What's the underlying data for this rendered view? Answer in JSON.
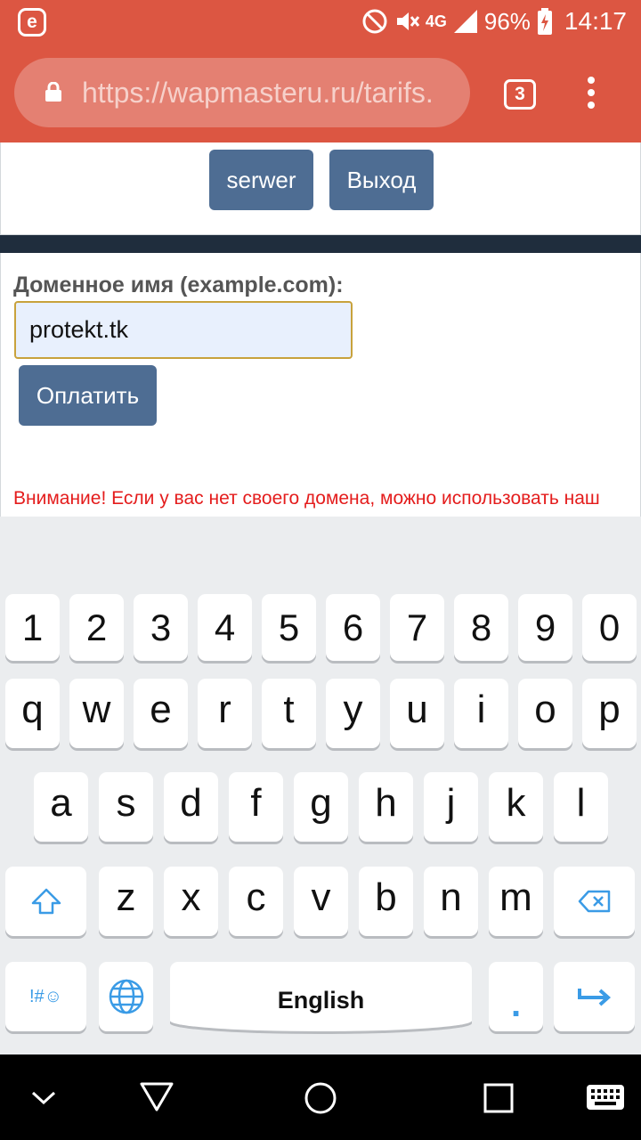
{
  "status": {
    "battery": "96%",
    "time": "14:17",
    "network": "4G"
  },
  "browser": {
    "url": "https://wapmasteru.ru/tarifs.",
    "tab_count": "3"
  },
  "page": {
    "serwer_button": "serwer",
    "exit_button": "Выход",
    "domain_label": "Доменное имя (example.com):",
    "domain_value": "protekt.tk",
    "pay_button": "Оплатить",
    "warning": "Внимание! Если у вас нет своего домена, можно использовать наш"
  },
  "keyboard": {
    "row_numbers": [
      "1",
      "2",
      "3",
      "4",
      "5",
      "6",
      "7",
      "8",
      "9",
      "0"
    ],
    "row_1": [
      "q",
      "w",
      "e",
      "r",
      "t",
      "y",
      "u",
      "i",
      "o",
      "p"
    ],
    "row_2": [
      "a",
      "s",
      "d",
      "f",
      "g",
      "h",
      "j",
      "k",
      "l"
    ],
    "row_3": [
      "z",
      "x",
      "c",
      "v",
      "b",
      "n",
      "m"
    ],
    "space_label": "English",
    "period_label": ".",
    "symbols_label": "!#☺"
  },
  "colors": {
    "toolbar": "#dc5642",
    "button": "#4e6d93",
    "warning": "#e41c1c",
    "key_accent": "#3a9be6"
  }
}
